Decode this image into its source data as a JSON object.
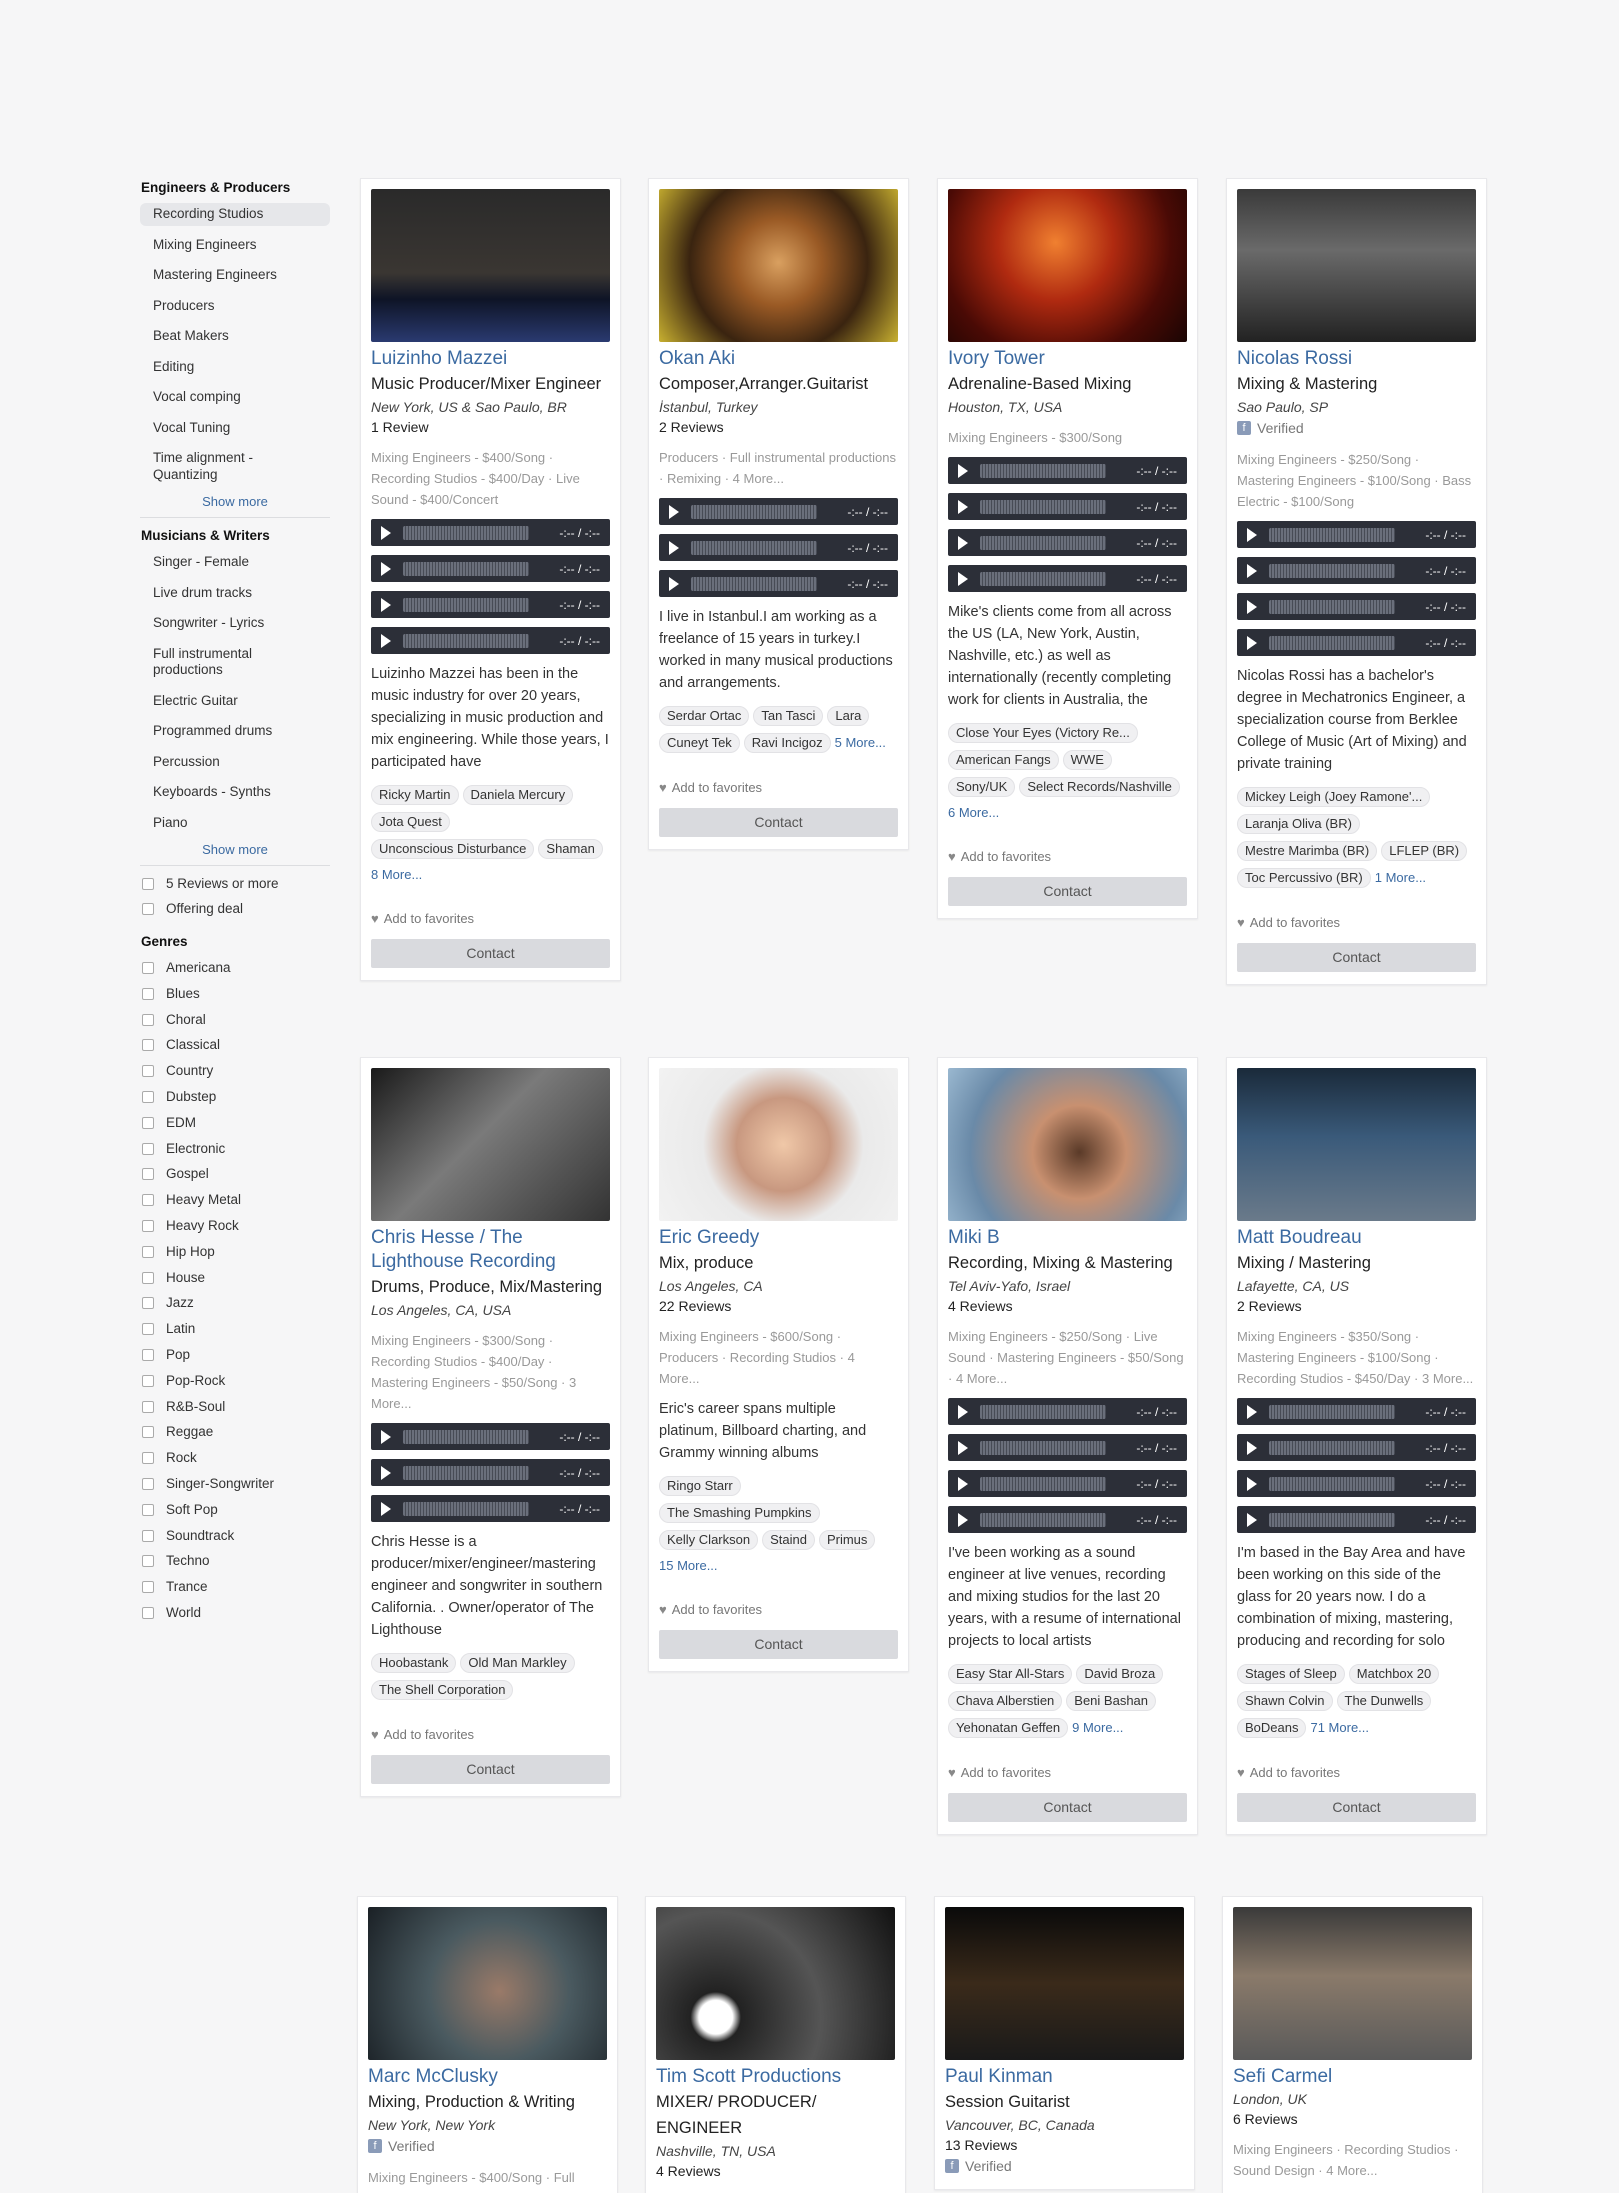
{
  "sidebar": {
    "engineers_heading": "Engineers & Producers",
    "engineers": [
      "Recording Studios",
      "Mixing Engineers",
      "Mastering Engineers",
      "Producers",
      "Beat Makers",
      "Editing",
      "Vocal comping",
      "Vocal Tuning",
      "Time alignment - Quantizing"
    ],
    "show_more_1": "Show more",
    "musicians_heading": "Musicians & Writers",
    "musicians": [
      "Singer - Female",
      "Live drum tracks",
      "Songwriter - Lyrics",
      "Full instrumental productions",
      "Electric Guitar",
      "Programmed drums",
      "Percussion",
      "Keyboards - Synths",
      "Piano"
    ],
    "show_more_2": "Show more",
    "filters": [
      "5 Reviews or more",
      "Offering deal"
    ],
    "genres_heading": "Genres",
    "genres": [
      "Americana",
      "Blues",
      "Choral",
      "Classical",
      "Country",
      "Dubstep",
      "EDM",
      "Electronic",
      "Gospel",
      "Heavy Metal",
      "Heavy Rock",
      "Hip Hop",
      "House",
      "Jazz",
      "Latin",
      "Pop",
      "Pop-Rock",
      "R&B-Soul",
      "Reggae",
      "Rock",
      "Singer-Songwriter",
      "Soft Pop",
      "Soundtrack",
      "Techno",
      "Trance",
      "World"
    ]
  },
  "common": {
    "time": "-:-- / -:--",
    "fav": "Add to favorites",
    "contact": "Contact",
    "verified": "Verified"
  },
  "cards": [
    {
      "name": "Luizinho Mazzei",
      "title": "Music Producer/Mixer Engineer",
      "loc": "New York, US & Sao Paulo, BR",
      "reviews": "1 Review",
      "services": "Mixing Engineers - $400/Song · Recording Studios - $400/Day · Live Sound - $400/Concert",
      "bio": "Luizinho Mazzei has been in the music industry for over 20 years, specializing in music production and mix engineering. While those years, I participated have",
      "credits": [
        "Ricky Martin",
        "Daniela Mercury",
        "Jota Quest",
        "Unconscious Disturbance",
        "Shaman"
      ],
      "more": "8 More..."
    },
    {
      "name": "Okan Aki",
      "title": "Composer,Arranger.Guitarist",
      "loc": "İstanbul, Turkey",
      "reviews": "2 Reviews",
      "services": "Producers · Full instrumental productions · Remixing · 4 More...",
      "bio": "I live in Istanbul.I am working as a freelance of 15 years in turkey.I worked in many musical productions and arrangements.",
      "credits": [
        "Serdar Ortac",
        "Tan Tasci",
        "Lara",
        "Cuneyt Tek",
        "Ravi Incigoz"
      ],
      "more": "5 More..."
    },
    {
      "name": "Ivory Tower",
      "title": "Adrenaline-Based Mixing",
      "loc": "Houston, TX, USA",
      "services": "Mixing Engineers - $300/Song",
      "bio": "Mike's clients come from all across the US (LA, New York, Austin, Nashville, etc.) as well as internationally (recently completing work for clients in Australia, the",
      "credits": [
        "Close Your Eyes (Victory Re...",
        "American Fangs",
        "WWE",
        "Sony/UK",
        "Select Records/Nashville"
      ],
      "more": "6 More..."
    },
    {
      "name": "Nicolas Rossi",
      "title": "Mixing & Mastering",
      "loc": "Sao Paulo, SP",
      "services": "Mixing Engineers - $250/Song · Mastering Engineers - $100/Song · Bass Electric - $100/Song",
      "bio": "Nicolas Rossi has a bachelor's degree in Mechatronics Engineer, a specialization course from Berklee College of Music (Art of Mixing) and private training",
      "credits": [
        "Mickey Leigh (Joey Ramone'...",
        "Laranja Oliva (BR)",
        "Mestre Marimba (BR)",
        "LFLEP (BR)",
        "Toc Percussivo (BR)"
      ],
      "more": "1 More..."
    },
    {
      "name": "Chris Hesse / The Lighthouse Recording",
      "title": "Drums, Produce, Mix/Mastering",
      "loc": "Los Angeles, CA, USA",
      "services": "Mixing Engineers - $300/Song · Recording Studios - $400/Day · Mastering Engineers - $50/Song · 3 More...",
      "bio": "Chris Hesse is a producer/mixer/engineer/mastering engineer and songwriter in southern California. . Owner/operator of The Lighthouse",
      "credits": [
        "Hoobastank",
        "Old Man Markley",
        "The Shell Corporation"
      ]
    },
    {
      "name": "Eric Greedy",
      "title": "Mix, produce",
      "loc": "Los Angeles, CA",
      "reviews": "22 Reviews",
      "services": "Mixing Engineers - $600/Song · Producers · Recording Studios · 4 More...",
      "bio": "Eric's career spans multiple platinum, Billboard charting, and Grammy winning albums",
      "credits": [
        "Ringo Starr",
        "The Smashing Pumpkins",
        "Kelly Clarkson",
        "Staind",
        "Primus"
      ],
      "more": "15 More..."
    },
    {
      "name": "Miki B",
      "title": "Recording, Mixing & Mastering",
      "loc": "Tel Aviv-Yafo, Israel",
      "reviews": "4 Reviews",
      "services": "Mixing Engineers - $250/Song · Live Sound · Mastering Engineers - $50/Song · 4 More...",
      "bio": "I've been working as a sound engineer at live venues, recording and mixing studios for the last 20 years, with a resume of international projects to local artists",
      "credits": [
        "Easy Star All-Stars",
        "David Broza",
        "Chava Alberstien",
        "Beni Bashan",
        "Yehonatan Geffen"
      ],
      "more": "9 More..."
    },
    {
      "name": "Matt Boudreau",
      "title": "Mixing / Mastering",
      "loc": "Lafayette, CA, US",
      "reviews": "2 Reviews",
      "services": "Mixing Engineers - $350/Song · Mastering Engineers - $100/Song · Recording Studios - $450/Day · 3 More...",
      "bio": "I'm based in the Bay Area and have been working on this side of the glass for 20 years now. I do a combination of mixing, mastering, producing and recording for solo",
      "credits": [
        "Stages of Sleep",
        "Matchbox 20",
        "Shawn Colvin",
        "The Dunwells",
        "BoDeans"
      ],
      "more": "71 More..."
    },
    {
      "name": "Marc McClusky",
      "title": "Mixing, Production & Writing",
      "loc": "New York, New York",
      "services": "Mixing Engineers - $400/Song · Full"
    },
    {
      "name": "Tim Scott Productions",
      "title": "MIXER/ PRODUCER/ ENGINEER",
      "loc": "Nashville, TN, USA",
      "reviews": "4 Reviews"
    },
    {
      "name": "Paul Kinman",
      "title": "Session Guitarist",
      "loc": "Vancouver, BC, Canada",
      "reviews": "13 Reviews"
    },
    {
      "name": "Sefi Carmel",
      "loc": "London, UK",
      "reviews": "6 Reviews",
      "services": "Mixing Engineers · Recording Studios · Sound Design · 4 More..."
    }
  ]
}
